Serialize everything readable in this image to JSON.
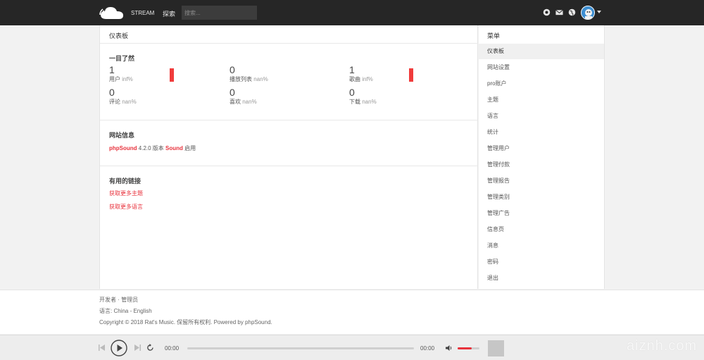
{
  "topbar": {
    "nav_stream": "STREAM",
    "nav_explore": "探索",
    "search_placeholder": "搜索...",
    "icons": [
      "play-circle-icon",
      "mail-icon",
      "globe-icon",
      "avatar",
      "chevron-down-icon"
    ]
  },
  "main": {
    "title": "仪表板",
    "overview": {
      "title": "一目了然",
      "stats": [
        {
          "value": "1",
          "label": "用户",
          "pct": "inf%",
          "bar": true
        },
        {
          "value": "0",
          "label": "播放列表",
          "pct": "nan%",
          "bar": false
        },
        {
          "value": "1",
          "label": "歌曲",
          "pct": "inf%",
          "bar": true
        },
        {
          "value": "0",
          "label": "评论",
          "pct": "nan%",
          "bar": false
        },
        {
          "value": "0",
          "label": "喜欢",
          "pct": "nan%",
          "bar": false
        },
        {
          "value": "0",
          "label": "下载",
          "pct": "nan%",
          "bar": false
        }
      ]
    },
    "site_info": {
      "title": "网站信息",
      "brand": "phpSound",
      "version_text": " 4.2.0 版本 ",
      "sound": "Sound",
      "status": " 启用"
    },
    "links": {
      "title": "有用的链接",
      "items": [
        "获取更多主题",
        "获取更多语言"
      ]
    }
  },
  "sidebar": {
    "title": "菜单",
    "items": [
      "仪表板",
      "网站设置",
      "pro账户",
      "主题",
      "语言",
      "统计",
      "管理用户",
      "管理付款",
      "管理报告",
      "管理类别",
      "管理广告",
      "信息页",
      "消息",
      "密码",
      "退出"
    ]
  },
  "footer": {
    "developer": "开发者",
    "separator": " · ",
    "admin": "管理员",
    "language_label": "语言: ",
    "language_china": "China",
    "language_dash": " - ",
    "language_english": "English",
    "copyright": "Copyright © 2018 Rat's Music. 保留所有权利. Powered by phpSound."
  },
  "player": {
    "current_time": "00:00",
    "total_time": "00:00",
    "volume_fraction": 0.65
  },
  "watermark": "aiznh.com",
  "colors": {
    "accent": "#e8323c",
    "topbar": "#262626"
  }
}
